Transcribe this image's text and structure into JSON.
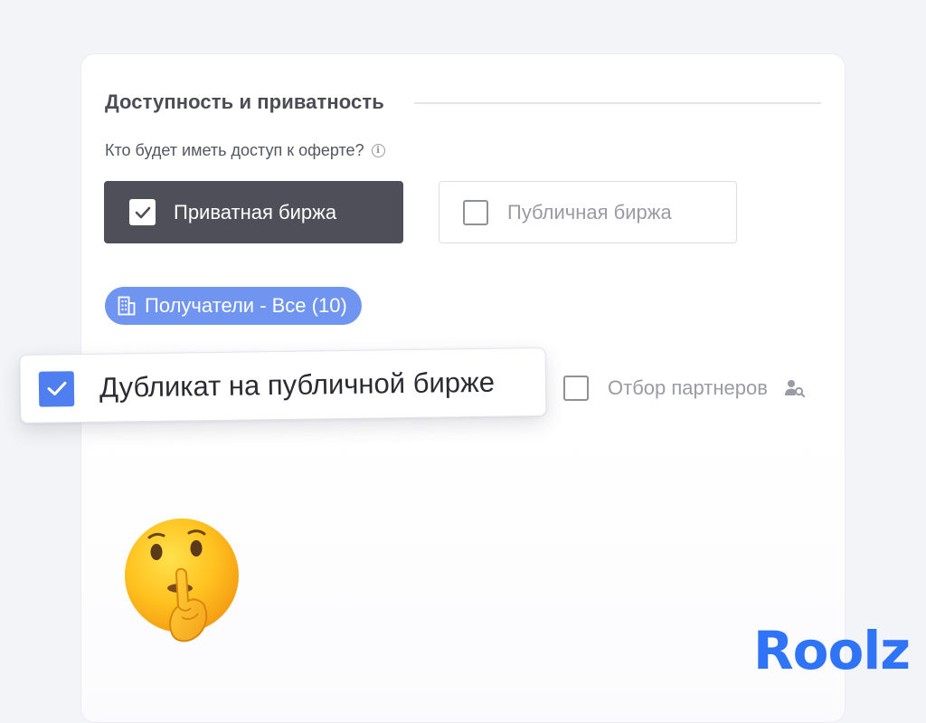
{
  "section": {
    "title": "Доступность и приватность",
    "question": "Кто будет иметь доступ к оферте?",
    "info_icon": "info-icon"
  },
  "options": {
    "private": {
      "label": "Приватная биржа",
      "checked": true
    },
    "public": {
      "label": "Публичная биржа",
      "checked": false
    }
  },
  "recipients": {
    "label": "Получатели - Все (10)",
    "icon": "building-icon"
  },
  "duplicate": {
    "label": "Дубликат на публичной бирже",
    "checked": true
  },
  "partners": {
    "label": "Отбор партнеров",
    "checked": false,
    "icon": "user-search-icon"
  },
  "brand": {
    "logo": "Roolz",
    "accent": "#4f7ef0",
    "dark": "#4e4f59",
    "pill": "#6f95f0",
    "logo_color": "#2f74f6"
  },
  "decoration": {
    "emoji": "shushing-face-emoji"
  }
}
